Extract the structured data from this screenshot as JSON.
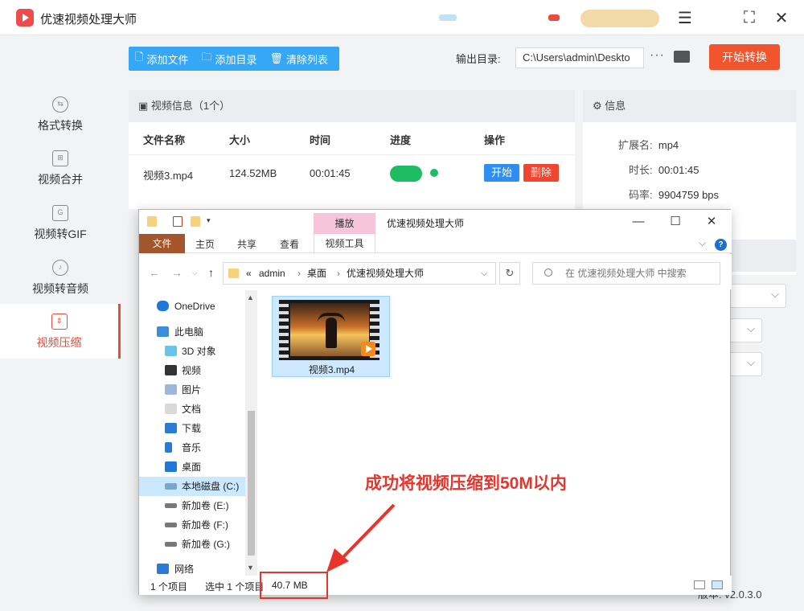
{
  "app": {
    "title": "优速视频处理大师"
  },
  "sidebar": {
    "items": [
      {
        "label": "格式转换",
        "icon": "convert-icon"
      },
      {
        "label": "视频合并",
        "icon": "merge-icon"
      },
      {
        "label": "视频转GIF",
        "icon": "gif-icon"
      },
      {
        "label": "视频转音频",
        "icon": "audio-icon"
      },
      {
        "label": "视频压缩",
        "icon": "compress-icon",
        "active": true
      }
    ]
  },
  "toolbar": {
    "add_file": "添加文件",
    "add_dir": "添加目录",
    "clear_list": "清除列表",
    "output_label": "输出目录:",
    "output_path": "C:\\Users\\admin\\Deskto",
    "more": "···",
    "start": "开始转换"
  },
  "video_panel": {
    "header": "视频信息（1个）",
    "columns": [
      "文件名称",
      "大小",
      "时间",
      "进度",
      "操作"
    ],
    "rows": [
      {
        "name": "视频3.mp4",
        "size": "124.52MB",
        "time": "00:01:45",
        "progress": 1.0,
        "op_start": "开始",
        "op_delete": "删除"
      }
    ]
  },
  "info_panel": {
    "header": "信息",
    "ext_label": "扩展名:",
    "ext": "mp4",
    "duration_label": "时长:",
    "duration": "00:01:45",
    "bitrate_label": "码率:",
    "bitrate": "9904759 bps"
  },
  "footer": {
    "version_label": "版本:",
    "version": "v2.0.3.0"
  },
  "explorer": {
    "title": "优速视频处理大师",
    "context_tab": "播放",
    "ribbon": {
      "file": "文件",
      "home": "主页",
      "share": "共享",
      "view": "查看",
      "video_tools": "视频工具"
    },
    "path": [
      "admin",
      "桌面",
      "优速视频处理大师"
    ],
    "path_prefix": "«",
    "search_placeholder": "在 优速视频处理大师 中搜索",
    "tree": [
      {
        "label": "OneDrive",
        "icon": "onedrive-icon"
      },
      {
        "label": "此电脑",
        "icon": "pc-icon"
      },
      {
        "label": "3D 对象",
        "icon": "3d-icon"
      },
      {
        "label": "视频",
        "icon": "video-folder-icon"
      },
      {
        "label": "图片",
        "icon": "pictures-icon"
      },
      {
        "label": "文档",
        "icon": "documents-icon"
      },
      {
        "label": "下载",
        "icon": "download-icon"
      },
      {
        "label": "音乐",
        "icon": "music-icon"
      },
      {
        "label": "桌面",
        "icon": "desktop-icon"
      },
      {
        "label": "本地磁盘 (C:)",
        "icon": "drive-c-icon",
        "selected": true
      },
      {
        "label": "新加卷 (E:)",
        "icon": "drive-icon"
      },
      {
        "label": "新加卷 (F:)",
        "icon": "drive-icon"
      },
      {
        "label": "新加卷 (G:)",
        "icon": "drive-icon"
      },
      {
        "label": "网络",
        "icon": "network-icon"
      }
    ],
    "file": {
      "name": "视频3.mp4"
    },
    "status": {
      "count": "1 个项目",
      "selected": "选中 1 个项目",
      "size": "40.7 MB"
    }
  },
  "annotation": {
    "text": "成功将视频压缩到50M以内",
    "color": "#e8352b"
  },
  "colors": {
    "accent": "#e84c3d",
    "blue": "#35a7f5",
    "start_btn": "#f2542d",
    "progress": "#1ebc63"
  }
}
